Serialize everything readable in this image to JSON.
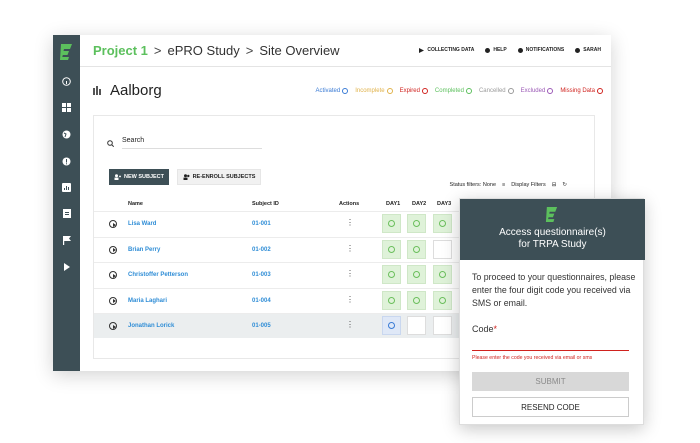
{
  "header": {
    "breadcrumb": [
      "Project 1",
      "ePRO Study",
      "Site Overview"
    ],
    "separator": ">",
    "nav": [
      "COLLECTING DATA",
      "HELP",
      "NOTIFICATIONS",
      "SARAH"
    ]
  },
  "site": {
    "name": "Aalborg"
  },
  "legend": [
    {
      "label": "Activated",
      "color": "#3a7bd5"
    },
    {
      "label": "Incomplete",
      "color": "#e0b24a"
    },
    {
      "label": "Expired",
      "color": "#d0221e"
    },
    {
      "label": "Completed",
      "color": "#5cc05d"
    },
    {
      "label": "Cancelled",
      "color": "#9a9a9a"
    },
    {
      "label": "Excluded",
      "color": "#9b59b6"
    },
    {
      "label": "Missing Data",
      "color": "#d0221e"
    }
  ],
  "search": {
    "label": "Search"
  },
  "buttons": {
    "new_subject": "NEW SUBJECT",
    "reenroll": "RE-ENROLL SUBJECTS"
  },
  "filters": {
    "status": "Status filters: None",
    "display": "Display Filters"
  },
  "table": {
    "headers": {
      "name": "Name",
      "subject_id": "Subject ID",
      "actions": "Actions",
      "day1": "DAY1",
      "day2": "DAY2",
      "day3": "DAY3"
    },
    "rows": [
      {
        "name": "Lisa Ward",
        "id": "01-001",
        "actions": "⋮",
        "days": [
          "completed",
          "completed",
          "completed"
        ]
      },
      {
        "name": "Brian Perry",
        "id": "01-002",
        "actions": "⋮",
        "days": [
          "completed",
          "completed",
          "empty"
        ]
      },
      {
        "name": "Christoffer Petterson",
        "id": "01-003",
        "actions": "⋮",
        "days": [
          "completed",
          "completed",
          "completed"
        ]
      },
      {
        "name": "Maria Laghari",
        "id": "01-004",
        "actions": "⋮",
        "days": [
          "completed",
          "completed",
          "completed"
        ]
      },
      {
        "name": "Jonathan Lorick",
        "id": "01-005",
        "actions": "⋮",
        "days": [
          "activated",
          "empty",
          "empty"
        ]
      }
    ]
  },
  "modal": {
    "title_line1": "Access questionnaire(s)",
    "title_line2": "for TRPA Study",
    "body": "To proceed to your questionnaires, please enter the four digit code you received via SMS or email.",
    "code_label": "Code",
    "required_mark": "*",
    "error": "Please enter the code you received via email or sms",
    "submit": "SUBMIT",
    "resend": "RESEND CODE"
  },
  "colors": {
    "sidebar": "#3d4f56",
    "accent": "#5cc05d",
    "link": "#2f8dd6",
    "error": "#d0221e"
  }
}
